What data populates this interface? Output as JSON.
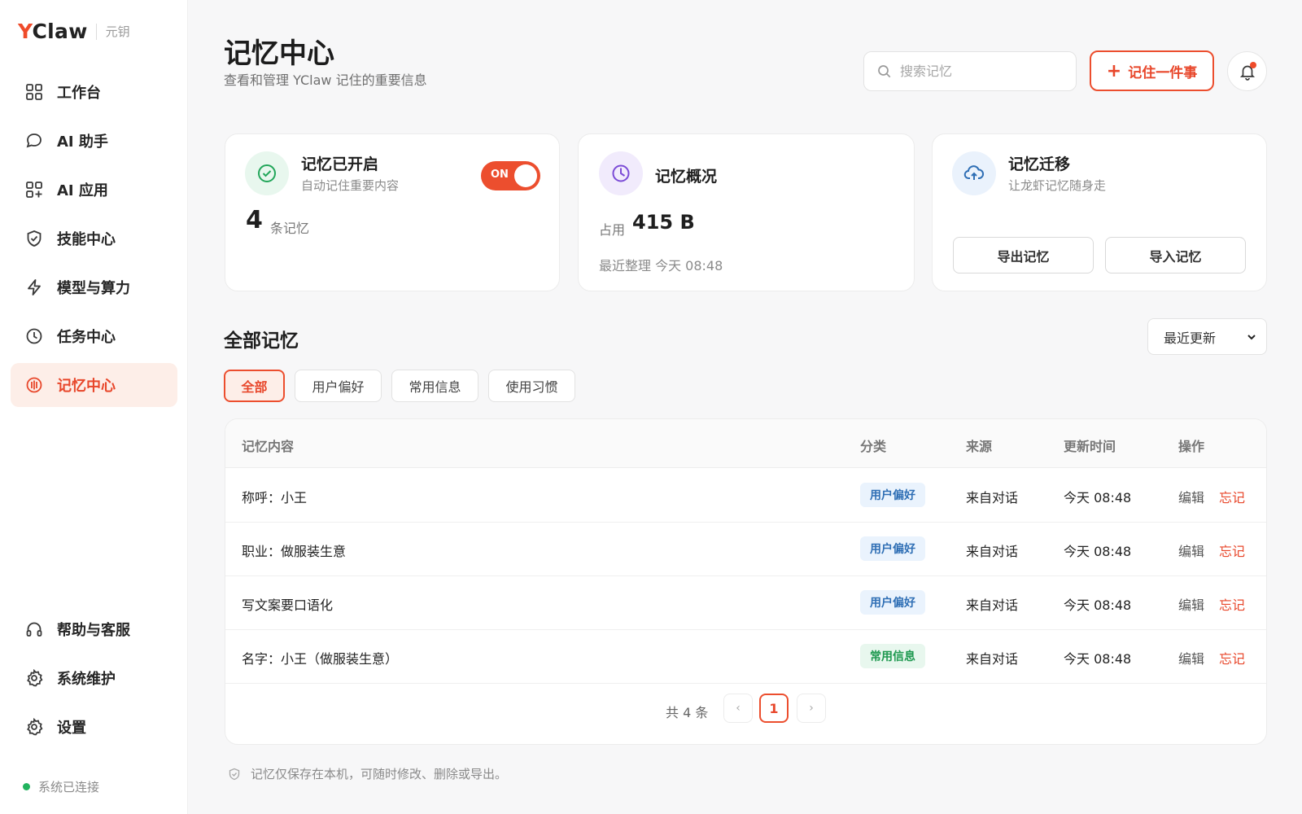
{
  "brand": {
    "name_first": "Y",
    "name_rest": "Claw",
    "sub": "元钥"
  },
  "nav": {
    "items": [
      {
        "label": "工作台",
        "icon": "grid-icon"
      },
      {
        "label": "AI 助手",
        "icon": "chat-bubble-icon"
      },
      {
        "label": "AI 应用",
        "icon": "apps-icon"
      },
      {
        "label": "技能中心",
        "icon": "shield-icon"
      },
      {
        "label": "模型与算力",
        "icon": "lightning-icon"
      },
      {
        "label": "任务中心",
        "icon": "clock-icon"
      },
      {
        "label": "记忆中心",
        "icon": "memory-icon",
        "active": true
      }
    ],
    "bottom": [
      {
        "label": "帮助与客服",
        "icon": "headset-icon"
      },
      {
        "label": "系统维护",
        "icon": "gear-icon"
      },
      {
        "label": "设置",
        "icon": "gear-icon"
      }
    ],
    "status": "系统已连接"
  },
  "header": {
    "title": "记忆中心",
    "subtitle": "查看和管理 YClaw 记住的重要信息",
    "search_placeholder": "搜索记忆",
    "remember_button": "记住一件事"
  },
  "cards": {
    "enabled": {
      "title": "记忆已开启",
      "subtitle": "自动记住重要内容",
      "toggle": "ON",
      "count": "4",
      "count_unit": "条记忆"
    },
    "overview": {
      "title": "记忆概况",
      "used_label": "占用",
      "used_value": "415 B",
      "last_tidy": "最近整理 今天 08:48"
    },
    "migration": {
      "title": "记忆迁移",
      "subtitle": "让龙虾记忆随身走",
      "export_button": "导出记忆",
      "import_button": "导入记忆"
    }
  },
  "section": {
    "title": "全部记忆",
    "sort_selected": "最近更新",
    "tabs": [
      "全部",
      "用户偏好",
      "常用信息",
      "使用习惯"
    ]
  },
  "table": {
    "headers": [
      "记忆内容",
      "分类",
      "来源",
      "更新时间",
      "操作"
    ],
    "rows": [
      {
        "content": "称呼：小王",
        "category": "用户偏好",
        "source": "来自对话",
        "time": "今天 08:48",
        "edit": "编辑",
        "forget": "忘记"
      },
      {
        "content": "职业：做服装生意",
        "category": "用户偏好",
        "source": "来自对话",
        "time": "今天 08:48",
        "edit": "编辑",
        "forget": "忘记"
      },
      {
        "content": "写文案要口语化",
        "category": "用户偏好",
        "source": "来自对话",
        "time": "今天 08:48",
        "edit": "编辑",
        "forget": "忘记"
      },
      {
        "content": "名字：小王（做服装生意）",
        "category": "常用信息",
        "source": "来自对话",
        "time": "今天 08:48",
        "edit": "编辑",
        "forget": "忘记"
      }
    ],
    "total": "共 4 条",
    "current_page": "1",
    "prev": "‹",
    "next": "›"
  },
  "footnote": "记忆仅保存在本机，可随时修改、删除或导出。",
  "colors": {
    "accent": "#ec4e2e",
    "pref_tag": "#2f6fb5",
    "info_tag": "#1f9950",
    "status_dot": "#22b35e"
  }
}
